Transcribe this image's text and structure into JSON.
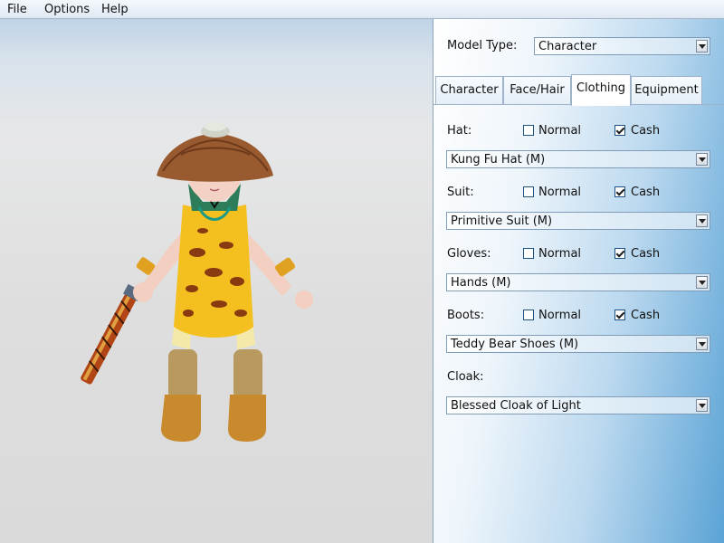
{
  "menu": {
    "items": [
      {
        "label": "File"
      },
      {
        "label": "Options"
      },
      {
        "label": "Help"
      }
    ]
  },
  "panel": {
    "model_type_label": "Model Type:",
    "model_type_value": "Character",
    "tabs": [
      {
        "label": "Character"
      },
      {
        "label": "Face/Hair"
      },
      {
        "label": "Clothing",
        "active": true
      },
      {
        "label": "Equipment"
      }
    ],
    "hat": {
      "label": "Hat:",
      "normal": "Normal",
      "cash": "Cash",
      "normal_checked": false,
      "cash_checked": true,
      "value": "Kung Fu Hat (M)"
    },
    "suit": {
      "label": "Suit:",
      "normal": "Normal",
      "cash": "Cash",
      "normal_checked": false,
      "cash_checked": true,
      "value": "Primitive Suit (M)"
    },
    "gloves": {
      "label": "Gloves:",
      "normal": "Normal",
      "cash": "Cash",
      "normal_checked": false,
      "cash_checked": true,
      "value": "Hands (M)"
    },
    "boots": {
      "label": "Boots:",
      "normal": "Normal",
      "cash": "Cash",
      "normal_checked": false,
      "cash_checked": true,
      "value": "Teddy Bear Shoes (M)"
    },
    "cloak": {
      "label": "Cloak:",
      "value": "Blessed Cloak of Light"
    }
  },
  "colors": {
    "accent": "#5aa3d6",
    "menubar": "#e6eef6",
    "suit_yellow": "#f3c020",
    "suit_spots": "#8a3a10"
  }
}
